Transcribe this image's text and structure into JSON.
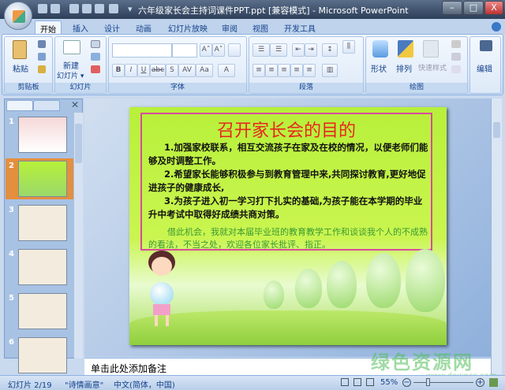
{
  "window": {
    "title": "六年级家长会主持词课件PPT.ppt [兼容模式] - Microsoft PowerPoint",
    "minimize": "–",
    "maximize": "□",
    "close": "X"
  },
  "tabs": [
    {
      "label": "开始",
      "active": true
    },
    {
      "label": "插入"
    },
    {
      "label": "设计"
    },
    {
      "label": "动画"
    },
    {
      "label": "幻灯片放映"
    },
    {
      "label": "审阅"
    },
    {
      "label": "视图"
    },
    {
      "label": "开发工具"
    }
  ],
  "ribbon": {
    "clipboard": {
      "label": "剪贴板",
      "paste": "粘贴"
    },
    "slides": {
      "label": "幻灯片",
      "new_slide_1": "新建",
      "new_slide_2": "幻灯片 ▾"
    },
    "font": {
      "label": "字体",
      "font_name": "",
      "font_size": "",
      "buttons": [
        "B",
        "I",
        "U",
        "abc",
        "S",
        "AV",
        "Aa",
        "A"
      ],
      "grow": "A˄",
      "shrink": "A˅"
    },
    "paragraph": {
      "label": "段落"
    },
    "drawing": {
      "label": "绘图",
      "shapes": "形状",
      "arrange": "排列",
      "quick_styles": "快速样式"
    },
    "editing": {
      "label": "编辑"
    }
  },
  "panel": {
    "thumbnails": [
      {
        "num": "1"
      },
      {
        "num": "2",
        "selected": true
      },
      {
        "num": "3"
      },
      {
        "num": "4"
      },
      {
        "num": "5"
      },
      {
        "num": "6"
      }
    ]
  },
  "slide": {
    "title": "召开家长会的目的",
    "points": [
      "1.加强家校联系，相互交流孩子在家及在校的情况，以便老师们能够及时调整工作。",
      "2.希望家长能够积极参与到教育管理中来,共同探讨教育,更好地促进孩子的健康成长,",
      "3.为孩子进入初一学习打下扎实的基础,为孩子能在本学期的毕业升中考试中取得好成绩共商对策。"
    ],
    "closing": "借此机会，我就对本届毕业班的教育教学工作和谈谈我个人的不成熟的看法，不当之处，欢迎各位家长批评、指正。",
    "colors": {
      "background": "#c4f246",
      "title": "#e8261e",
      "border": "#d84b9c",
      "closing": "#3a9a34"
    }
  },
  "notes": {
    "placeholder": "单击此处添加备注"
  },
  "status": {
    "slide": "幻灯片 2/19",
    "theme": "\"诗情画意\"",
    "language": "中文(简体，中国)",
    "zoom": "55%"
  },
  "watermark": {
    "text": "绿色资源网",
    "url": "www.downcc.com"
  }
}
